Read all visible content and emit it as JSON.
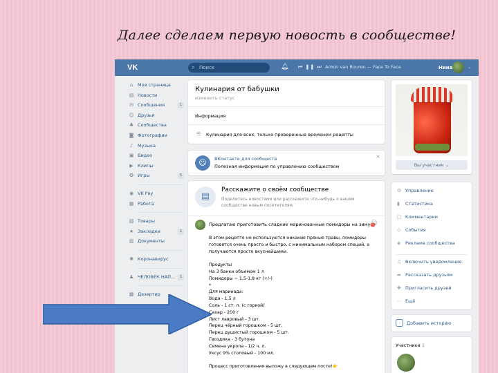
{
  "slide": {
    "title": "Далее сделаем первую новость в сообществе!"
  },
  "topbar": {
    "logo": "VK",
    "search_placeholder": "Поиск",
    "player_controls": "⏮ ❚❚ ⏭",
    "track": "Armin van Buuren — Face To Face",
    "username": "Нина"
  },
  "leftnav": {
    "items": [
      {
        "icon": "⌂",
        "label": "Моя страница",
        "count": ""
      },
      {
        "icon": "▤",
        "label": "Новости",
        "count": ""
      },
      {
        "icon": "✉",
        "label": "Сообщения",
        "count": "1"
      },
      {
        "icon": "☺",
        "label": "Друзья",
        "count": ""
      },
      {
        "icon": "♣",
        "label": "Сообщества",
        "count": ""
      },
      {
        "icon": "◙",
        "label": "Фотографии",
        "count": ""
      },
      {
        "icon": "♪",
        "label": "Музыка",
        "count": ""
      },
      {
        "icon": "▣",
        "label": "Видео",
        "count": ""
      },
      {
        "icon": "▶",
        "label": "Клипы",
        "count": ""
      },
      {
        "icon": "✪",
        "label": "Игры",
        "count": "5"
      }
    ],
    "items2": [
      {
        "icon": "◉",
        "label": "VK Pay",
        "count": ""
      },
      {
        "icon": "▦",
        "label": "Работа",
        "count": ""
      }
    ],
    "items3": [
      {
        "icon": "▧",
        "label": "Товары",
        "count": ""
      },
      {
        "icon": "★",
        "label": "Закладки",
        "count": "1"
      },
      {
        "icon": "▥",
        "label": "Документы",
        "count": ""
      }
    ],
    "items4": [
      {
        "icon": "✺",
        "label": "Коронавирус",
        "count": ""
      }
    ],
    "items5": [
      {
        "icon": "♟",
        "label": "ЧЕЛОВЕК НАП...",
        "count": "1"
      }
    ],
    "items6": [
      {
        "icon": "▩",
        "label": "Дезертир",
        "count": ""
      }
    ]
  },
  "group": {
    "name": "Кулинария от бабушки",
    "status_placeholder": "изменить статус",
    "info_label": "Информация",
    "description": "Кулинария для всех, только проверенные временем рецепты"
  },
  "app_banner": {
    "title": "ВКонтакте для сообществ",
    "subtitle": "Полезная информация по управлению сообществом",
    "close": "×"
  },
  "post_prompt": {
    "title": "Расскажите о своём сообществе",
    "subtitle": "Поделитесь новостями или расскажите что-нибудь о вашем сообществе новым посетителям."
  },
  "post": {
    "intro": "Предлагаю приготовить сладкие маринованные помидоры на зиму🍅",
    "lines": [
      "В этом рецепте не используются никакие пряные травы, помидоры",
      "готовятся очень просто и быстро, с минимальным набором специй, а",
      "получаются просто вкуснейшими.",
      "",
      "Продукты",
      "На 3 банки объемом 1 л",
      "Помидоры ~ 1,5-1,8 кг (+/-)",
      "*",
      "Для маринада:",
      "Вода - 1,5 л",
      "Соль - 1 ст. л. (с горкой)",
      "Сахар - 200 г",
      "Лист лавровый - 3 шт.",
      "Перец чёрный горошком - 5 шт.",
      "Перец душистый горошком - 5 шт.",
      "Гвоздика - 3 бутона",
      "Семена укропа - 1/2 ч. л.",
      "Уксус 9% столовый - 100 мл.",
      "",
      "Процесс приготовления выложу в следующем посте!👉"
    ]
  },
  "sidebar": {
    "members_button": "Вы участник ⌄",
    "manage": [
      {
        "icon": "⚙",
        "label": "Управление"
      },
      {
        "icon": "▮",
        "label": "Статистика"
      },
      {
        "icon": "▢",
        "label": "Комментарии"
      },
      {
        "icon": "◇",
        "label": "События"
      },
      {
        "icon": "◈",
        "label": "Реклама сообщества"
      }
    ],
    "actions": [
      {
        "icon": "♫",
        "label": "Включить уведомления"
      },
      {
        "icon": "➦",
        "label": "Рассказать друзьям"
      },
      {
        "icon": "✚",
        "label": "Пригласить друзей"
      },
      {
        "icon": "⋯",
        "label": "Ещё"
      }
    ],
    "story": "Добавить историю",
    "members_title": "Участники",
    "members_count": "1"
  }
}
